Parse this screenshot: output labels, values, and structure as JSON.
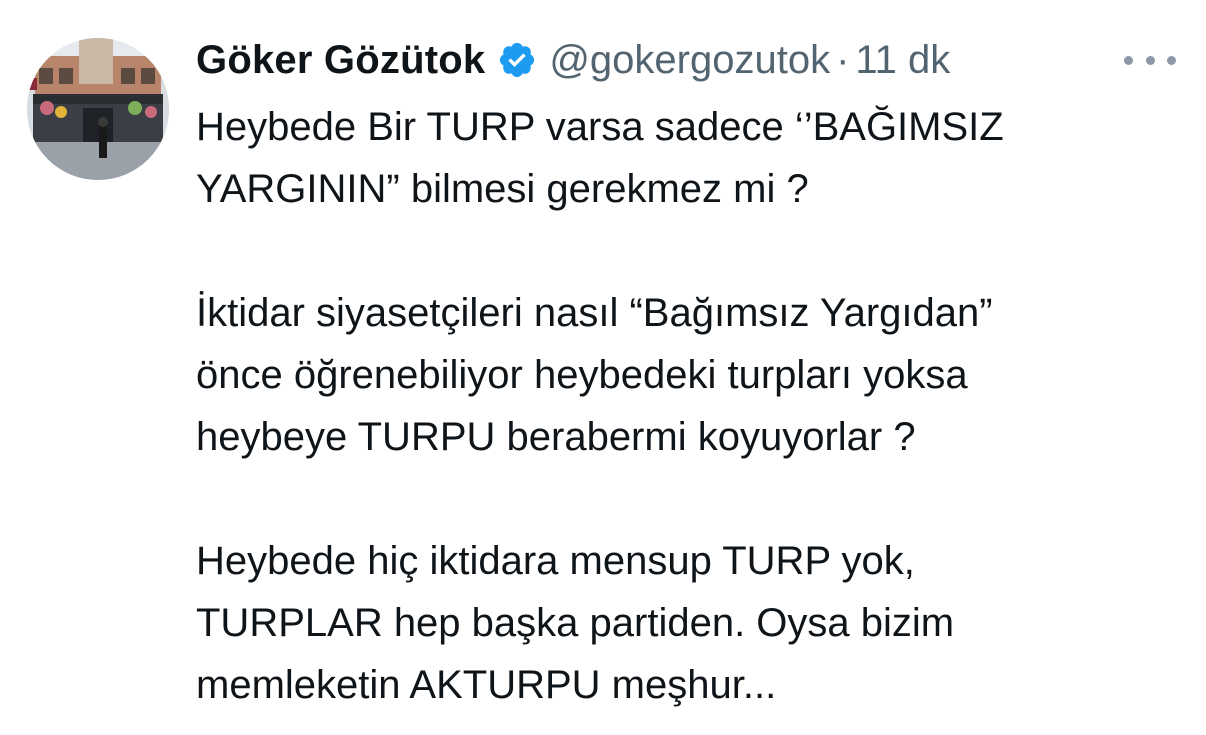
{
  "tweet": {
    "display_name": "Göker Gözütok",
    "verified_icon": "verified-badge-icon",
    "handle": "@gokergozutok",
    "separator": "·",
    "time": "11 dk",
    "more_icon": "more-options-icon",
    "paragraphs": [
      "Heybede Bir TURP varsa sadece ‘’BAĞIMSIZ\nYARGININ” bilmesi gerekmez mi ?",
      "İktidar siyasetçileri nasıl “Bağımsız Yargıdan”\nönce öğrenebiliyor heybedeki turpları yoksa\nheybeye TURPU berabermi koyuyorlar ?",
      "Heybede hiç iktidara mensup TURP yok,\nTURPLAR hep başka partiden. Oysa bizim\nmemleketin AKTURPU meşhur..."
    ]
  },
  "colors": {
    "text": "#0f1419",
    "secondary": "#536471",
    "verified": "#1d9bf0"
  }
}
